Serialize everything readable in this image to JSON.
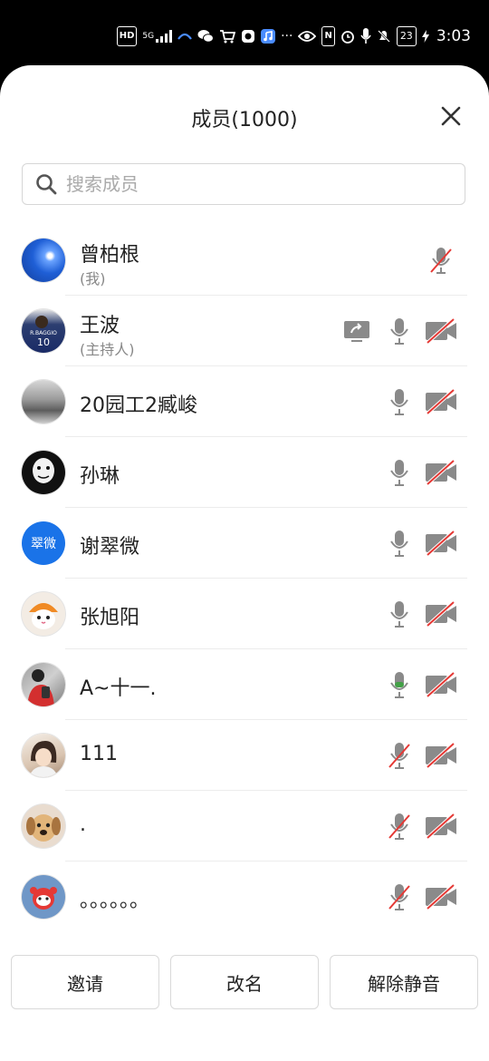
{
  "status_bar": {
    "hd_label": "HD",
    "network_label": "5G",
    "dots": "···",
    "nfc_label": "N",
    "battery": "23",
    "time": "3:03"
  },
  "sheet": {
    "title": "成员(1000)"
  },
  "search": {
    "placeholder": "搜索成员"
  },
  "members": [
    {
      "name": "曾柏根",
      "sub": "(我)",
      "avatar": "blue-sky-avatar",
      "mic": "muted",
      "cam": "none",
      "share": false
    },
    {
      "name": "王波",
      "sub": "(主持人)",
      "avatar": "soccer-player-avatar",
      "mic": "on",
      "cam": "off",
      "share": true
    },
    {
      "name": "20园工2臧峻",
      "sub": "",
      "avatar": "landscape-avatar",
      "mic": "on",
      "cam": "off",
      "share": false
    },
    {
      "name": "孙琳",
      "sub": "",
      "avatar": "meme-face-avatar",
      "mic": "on",
      "cam": "off",
      "share": false
    },
    {
      "name": "谢翠微",
      "sub": "",
      "avatar_text": "翠微",
      "avatar": "text-avatar",
      "mic": "on",
      "cam": "off",
      "share": false
    },
    {
      "name": "张旭阳",
      "sub": "",
      "avatar": "cat-avatar",
      "mic": "on",
      "cam": "off",
      "share": false
    },
    {
      "name": "A~十一.",
      "sub": "",
      "avatar": "red-outfit-avatar",
      "mic": "active",
      "cam": "off",
      "share": false
    },
    {
      "name": " 111",
      "sub": "",
      "avatar": "girl-photo-avatar",
      "mic": "muted",
      "cam": "off",
      "share": false
    },
    {
      "name": ".",
      "sub": "",
      "avatar": "dog-avatar",
      "mic": "muted",
      "cam": "off",
      "share": false
    },
    {
      "name": "。。。。。。",
      "sub": "",
      "avatar": "cartoon-avatar",
      "mic": "muted",
      "cam": "off",
      "share": false
    }
  ],
  "actions": {
    "invite": "邀请",
    "rename": "改名",
    "unmute_all": "解除静音"
  },
  "colors": {
    "accent_blue": "#1a73e8",
    "mute_red": "#e53935",
    "icon_gray": "#8a8a8a",
    "active_green": "#43a047"
  }
}
